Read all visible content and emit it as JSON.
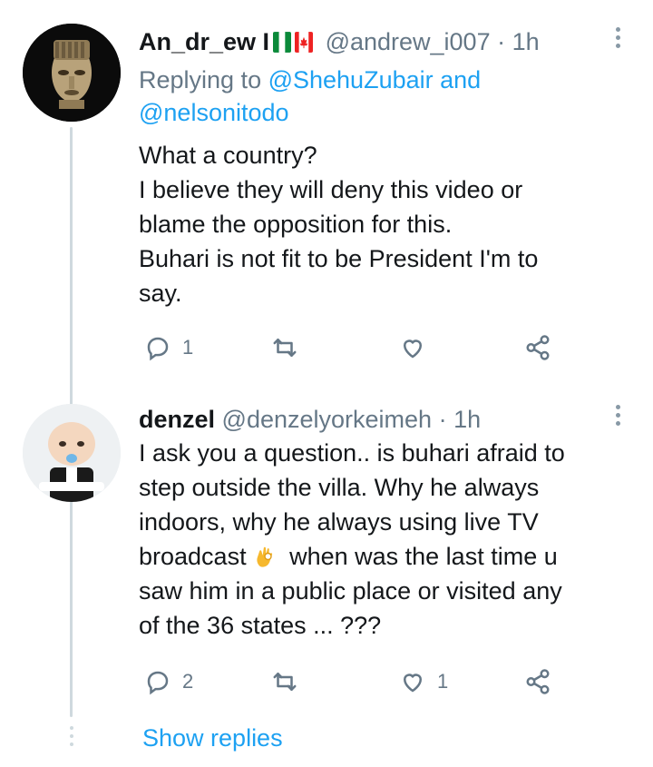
{
  "tweets": [
    {
      "name": "An_dr_ew I",
      "handle": "@andrew_i007",
      "separator": "·",
      "time": "1h",
      "replying_prefix": "Replying to ",
      "replying_mention1": "@ShehuZubair",
      "replying_and": " and",
      "replying_mention2": "@nelsonitodo",
      "lines": [
        "What a country?",
        "I believe they will deny this video or",
        "blame the opposition for this.",
        "Buhari is not fit to be President I'm to",
        "say."
      ],
      "reply_count": "1",
      "retweet_count": "",
      "like_count": ""
    },
    {
      "name": "denzel",
      "handle": "@denzelyorkeimeh",
      "separator": "·",
      "time": "1h",
      "lines": [
        "I ask you a question.. is buhari afraid to",
        "step outside the villa. Why he always",
        "indoors, why he always using live TV",
        "broadcast",
        " when was the last time u",
        "saw him in a public place or visited any",
        "of the 36 states ... ???"
      ],
      "reply_count": "2",
      "retweet_count": "",
      "like_count": "1"
    }
  ],
  "show_replies": "Show replies",
  "colors": {
    "accent": "#1da1f2",
    "secondary_text": "#657786",
    "thread_line": "#cfd9de"
  },
  "icons": [
    "reply-icon",
    "retweet-icon",
    "like-icon",
    "share-icon",
    "more-icon",
    "ok-hand-emoji",
    "nigeria-flag-icon",
    "canada-flag-icon"
  ]
}
